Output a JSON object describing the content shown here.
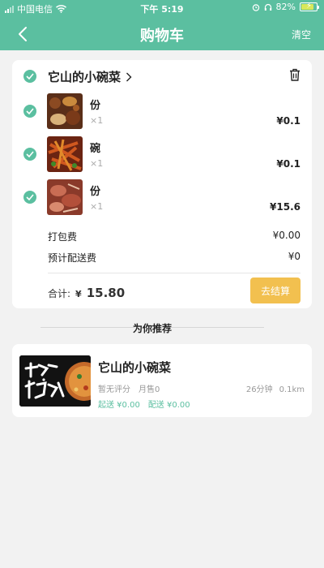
{
  "status_bar": {
    "carrier": "中国电信",
    "time": "下午 5:19",
    "battery": "82%"
  },
  "header": {
    "title": "购物车",
    "clear_label": "清空"
  },
  "cart": {
    "shop_name": "它山的小碗菜",
    "items": [
      {
        "unit": "份",
        "qty": "×1",
        "price": "¥0.1"
      },
      {
        "unit": "碗",
        "qty": "×1",
        "price": "¥0.1"
      },
      {
        "unit": "份",
        "qty": "×1",
        "price": "¥15.6"
      }
    ],
    "fees": {
      "packaging_label": "打包费",
      "packaging_value": "¥0.00",
      "delivery_label": "预计配送费",
      "delivery_value": "¥0"
    },
    "total_label": "合计:",
    "total_currency": "¥",
    "total_amount": "15.80",
    "checkout_label": "去结算"
  },
  "recommend": {
    "heading": "为你推荐",
    "shop": {
      "name": "它山的小碗菜",
      "rating": "暂无评分",
      "sales": "月售0",
      "time": "26分钟",
      "distance": "0.1km",
      "min_order": "起送 ¥0.00",
      "delivery_fee": "配送 ¥0.00"
    }
  },
  "colors": {
    "accent": "#5bbfa0",
    "checkout": "#f2c04f"
  }
}
